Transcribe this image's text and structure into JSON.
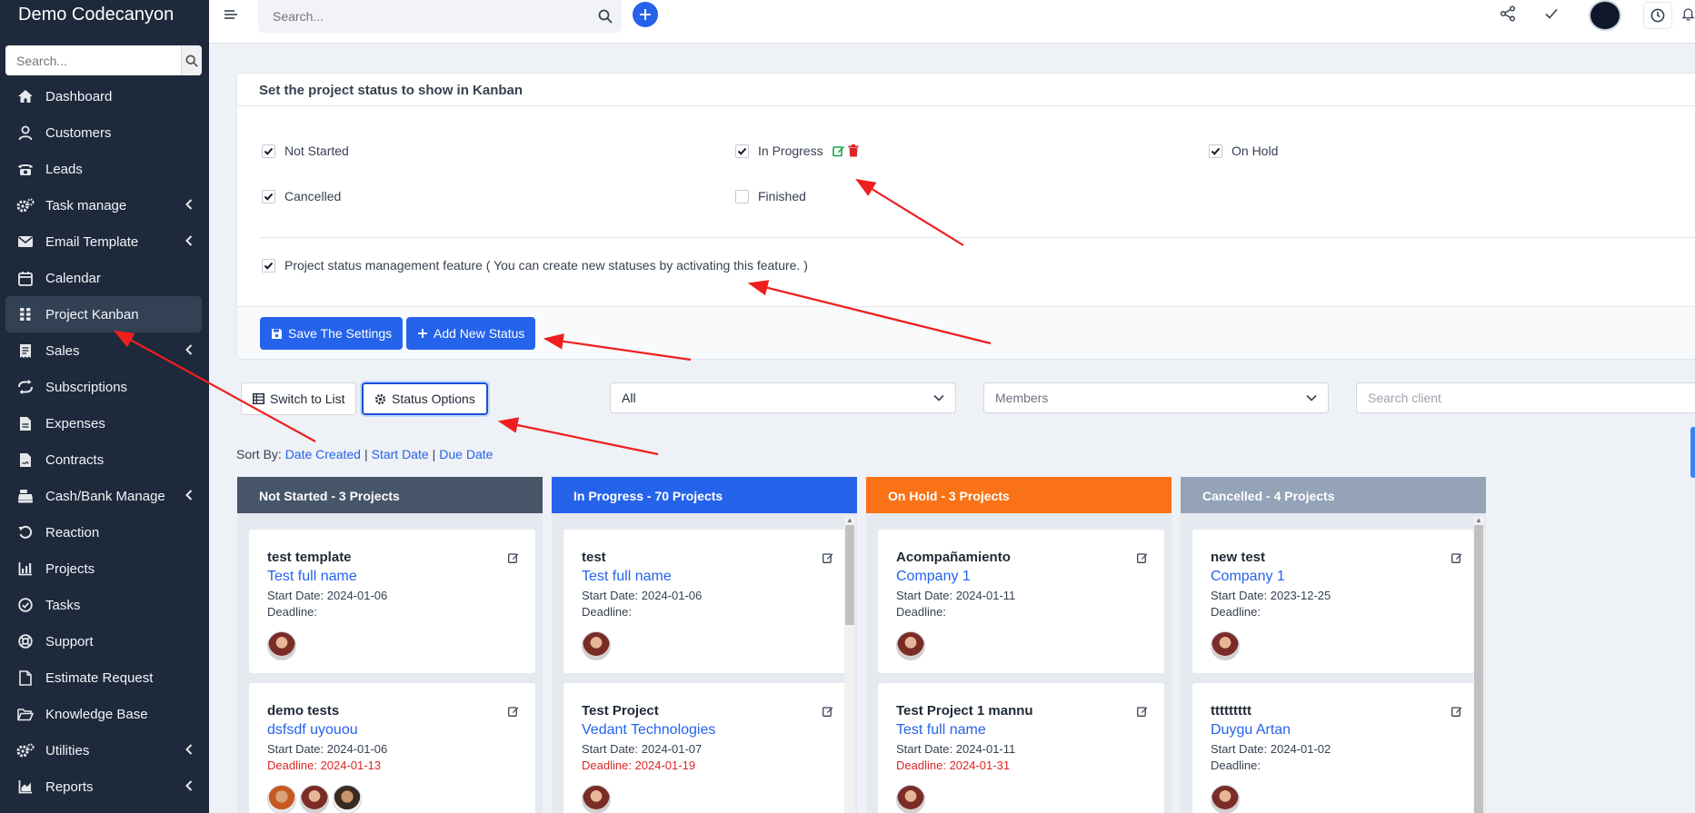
{
  "sidebar": {
    "brand": "Demo Codecanyon",
    "search_placeholder": "Search...",
    "items": [
      {
        "label": "Dashboard",
        "icon": "home-icon"
      },
      {
        "label": "Customers",
        "icon": "user-icon"
      },
      {
        "label": "Leads",
        "icon": "phone-icon"
      },
      {
        "label": "Task manage",
        "icon": "gears-icon",
        "chevron": true
      },
      {
        "label": "Email Template",
        "icon": "envelope-icon",
        "chevron": true
      },
      {
        "label": "Calendar",
        "icon": "calendar-icon"
      },
      {
        "label": "Project Kanban",
        "icon": "grid-icon",
        "active": true
      },
      {
        "label": "Sales",
        "icon": "receipt-icon",
        "chevron": true
      },
      {
        "label": "Subscriptions",
        "icon": "repeat-icon"
      },
      {
        "label": "Expenses",
        "icon": "file-icon"
      },
      {
        "label": "Contracts",
        "icon": "file-contract-icon"
      },
      {
        "label": "Cash/Bank Manage",
        "icon": "cash-register-icon",
        "chevron": true
      },
      {
        "label": "Reaction",
        "icon": "undo-icon"
      },
      {
        "label": "Projects",
        "icon": "chart-bar-icon"
      },
      {
        "label": "Tasks",
        "icon": "check-circle-icon"
      },
      {
        "label": "Support",
        "icon": "life-ring-icon"
      },
      {
        "label": "Estimate Request",
        "icon": "file-alt-icon"
      },
      {
        "label": "Knowledge Base",
        "icon": "folder-open-icon"
      },
      {
        "label": "Utilities",
        "icon": "cogs-icon",
        "chevron": true
      },
      {
        "label": "Reports",
        "icon": "chart-area-icon",
        "chevron": true
      }
    ]
  },
  "topbar": {
    "search_placeholder": "Search..."
  },
  "settings_panel": {
    "title": "Set the project status to show in Kanban",
    "statuses": [
      {
        "label": "Not Started",
        "checked": true
      },
      {
        "label": "In Progress",
        "checked": true
      },
      {
        "label": "On Hold",
        "checked": true
      },
      {
        "label": "Cancelled",
        "checked": true
      },
      {
        "label": "Finished",
        "checked": false
      }
    ],
    "feature_label": "Project status management feature ( You can create new statuses by activating this feature. )",
    "save_label": "Save The Settings",
    "add_label": "Add New Status"
  },
  "toolbar": {
    "switch_label": "Switch to List",
    "status_options_label": "Status Options",
    "filter_value": "All",
    "members_placeholder": "Members",
    "search_client_placeholder": "Search client"
  },
  "sort": {
    "label": "Sort By:",
    "options": [
      "Date Created",
      "Start Date",
      "Due Date"
    ]
  },
  "kanban": {
    "columns": [
      {
        "title": "Not Started - 3 Projects",
        "color": "#475569",
        "cards": [
          {
            "title": "test template",
            "client": "Test full name",
            "start": "Start Date: 2024-01-06",
            "deadline_label": "Deadline:",
            "deadline": ""
          },
          {
            "title": "demo tests",
            "client": "dsfsdf uyouou",
            "start": "Start Date: 2024-01-06",
            "deadline_label": "Deadline:",
            "deadline": "2024-01-13"
          }
        ]
      },
      {
        "title": "In Progress - 70 Projects",
        "color": "#2563eb",
        "cards": [
          {
            "title": "test",
            "client": "Test full name",
            "start": "Start Date: 2024-01-06",
            "deadline_label": "Deadline:",
            "deadline": ""
          },
          {
            "title": "Test Project",
            "client": "Vedant Technologies",
            "start": "Start Date: 2024-01-07",
            "deadline_label": "Deadline:",
            "deadline": "2024-01-19"
          }
        ]
      },
      {
        "title": "On Hold - 3 Projects",
        "color": "#f97316",
        "cards": [
          {
            "title": "Acompañamiento",
            "client": "Company 1",
            "start": "Start Date: 2024-01-11",
            "deadline_label": "Deadline:",
            "deadline": ""
          },
          {
            "title": "Test Project 1 mannu",
            "client": "Test full name",
            "start": "Start Date: 2024-01-11",
            "deadline_label": "Deadline:",
            "deadline": "2024-01-31"
          }
        ]
      },
      {
        "title": "Cancelled - 4 Projects",
        "color": "#94a3b8",
        "cards": [
          {
            "title": "new test",
            "client": "Company 1",
            "start": "Start Date: 2023-12-25",
            "deadline_label": "Deadline:",
            "deadline": ""
          },
          {
            "title": "ttttttttt",
            "client": "Duygu Artan",
            "start": "Start Date: 2024-01-02",
            "deadline_label": "Deadline:",
            "deadline": ""
          }
        ]
      }
    ]
  },
  "colors": {
    "accent": "#2563eb",
    "sidebar_bg": "#1e293b",
    "danger": "#dc2626",
    "annotation_arrow": "#ef1f1f"
  }
}
